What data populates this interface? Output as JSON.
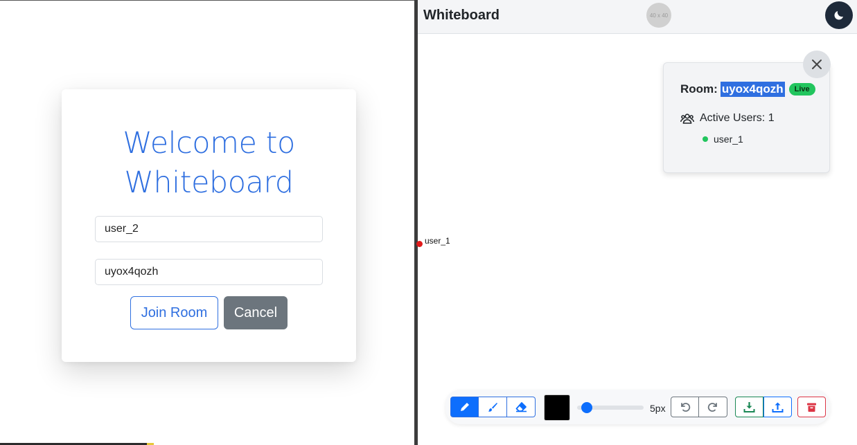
{
  "login": {
    "title_line1": "Welcome to",
    "title_line2": "Whiteboard",
    "username_value": "user_2",
    "room_id_value": "uyox4qozh",
    "join_label": "Join Room",
    "cancel_label": "Cancel"
  },
  "app": {
    "title": "Whiteboard",
    "avatar_placeholder": "40 x 40",
    "theme_icon": "moon-icon"
  },
  "canvas": {
    "cursor_user": "user_1"
  },
  "room_panel": {
    "room_prefix": "Room:",
    "room_code": "uyox4qozh",
    "live_badge": "Live",
    "active_users_label": "Active Users: 1",
    "users": [
      "user_1"
    ],
    "close_icon": "close-icon"
  },
  "toolbar": {
    "tools": [
      "pencil-icon",
      "brush-icon",
      "eraser-icon"
    ],
    "active_tool": "pencil",
    "color": "#000000",
    "brush_size_label": "5px",
    "brush_size_value": 5,
    "history": [
      "undo-icon",
      "redo-icon"
    ],
    "file": [
      "download-icon",
      "upload-icon"
    ],
    "clear": "trash-icon"
  },
  "colors": {
    "accent": "#2f6fe0",
    "primary": "#0d6efd",
    "live": "#22c55e",
    "danger": "#dc3545",
    "success": "#198754",
    "secondary": "#6c757d"
  }
}
